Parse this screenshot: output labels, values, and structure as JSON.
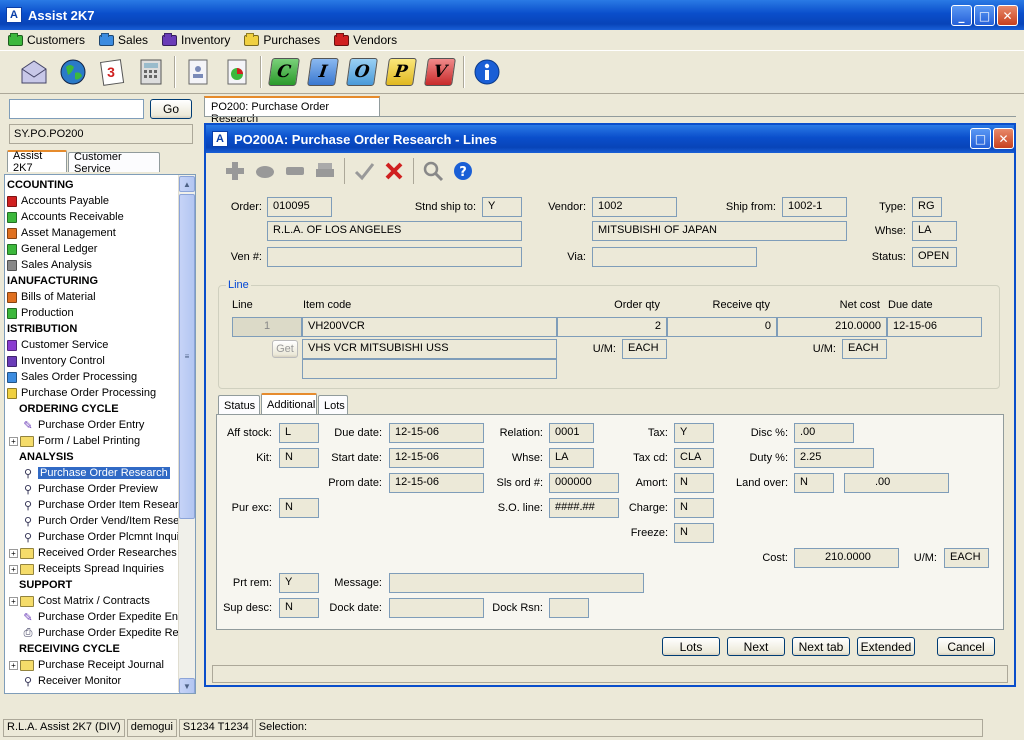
{
  "window": {
    "title": "Assist 2K7"
  },
  "menu": [
    {
      "label": "Customers",
      "color": "#3cb83c"
    },
    {
      "label": "Sales",
      "color": "#3c8ce0"
    },
    {
      "label": "Inventory",
      "color": "#6a3cb8"
    },
    {
      "label": "Purchases",
      "color": "#f0d040"
    },
    {
      "label": "Vendors",
      "color": "#d02020"
    }
  ],
  "toolbar": {
    "calendar_day": "3",
    "letters": [
      "C",
      "I",
      "O",
      "P",
      "V"
    ]
  },
  "left": {
    "search_value": "",
    "go_label": "Go",
    "path": "SY.PO.PO200",
    "tabs": [
      "Assist 2K7",
      "Customer Service"
    ]
  },
  "tree": {
    "items": [
      {
        "label": "CCOUNTING",
        "kind": "hdr"
      },
      {
        "label": "Accounts Payable",
        "kind": "item",
        "color": "#d02020"
      },
      {
        "label": "Accounts Receivable",
        "kind": "item",
        "color": "#3cb83c"
      },
      {
        "label": "Asset Management",
        "kind": "item",
        "color": "#e07020"
      },
      {
        "label": "General Ledger",
        "kind": "item",
        "color": "#3cb83c"
      },
      {
        "label": "Sales Analysis",
        "kind": "item",
        "color": "#888888"
      },
      {
        "label": "IANUFACTURING",
        "kind": "hdr"
      },
      {
        "label": "Bills of Material",
        "kind": "item",
        "color": "#e07020"
      },
      {
        "label": "Production",
        "kind": "item",
        "color": "#3cb83c"
      },
      {
        "label": "ISTRIBUTION",
        "kind": "hdr"
      },
      {
        "label": "Customer Service",
        "kind": "item",
        "color": "#8a3cd0"
      },
      {
        "label": "Inventory Control",
        "kind": "item",
        "color": "#6a3cb8"
      },
      {
        "label": "Sales Order Processing",
        "kind": "item",
        "color": "#3c8ce0"
      },
      {
        "label": "Purchase Order Processing",
        "kind": "item",
        "color": "#f0d040"
      },
      {
        "label": "ORDERING CYCLE",
        "kind": "sub"
      },
      {
        "label": "Purchase Order Entry",
        "kind": "leaf",
        "icon": "pencil"
      },
      {
        "label": "Form / Label Printing",
        "kind": "folder"
      },
      {
        "label": "ANALYSIS",
        "kind": "sub"
      },
      {
        "label": "Purchase Order Research",
        "kind": "leaf",
        "icon": "magnifier",
        "selected": true
      },
      {
        "label": "Purchase Order Preview",
        "kind": "leaf",
        "icon": "magnifier"
      },
      {
        "label": "Purchase Order Item Resear",
        "kind": "leaf",
        "icon": "magnifier"
      },
      {
        "label": "Purch Order Vend/Item Rese",
        "kind": "leaf",
        "icon": "magnifier"
      },
      {
        "label": "Purchase Order Plcmnt Inqui",
        "kind": "leaf",
        "icon": "magnifier"
      },
      {
        "label": "Received Order Researches",
        "kind": "folder"
      },
      {
        "label": "Receipts Spread Inquiries",
        "kind": "folder"
      },
      {
        "label": "SUPPORT",
        "kind": "sub"
      },
      {
        "label": "Cost Matrix / Contracts",
        "kind": "folder"
      },
      {
        "label": "Purchase Order Expedite Ent",
        "kind": "leaf",
        "icon": "pencil"
      },
      {
        "label": "Purchase Order Expedite Re",
        "kind": "leaf",
        "icon": "printer"
      },
      {
        "label": "RECEIVING CYCLE",
        "kind": "sub"
      },
      {
        "label": "Purchase Receipt Journal",
        "kind": "folder"
      },
      {
        "label": "Receiver Monitor",
        "kind": "leaf",
        "icon": "magnifier"
      }
    ]
  },
  "doc_tab": "PO200: Purchase Order Research",
  "inner": {
    "title": "PO200A: Purchase Order Research - Lines",
    "header": {
      "order_label": "Order:",
      "order": "010095",
      "stnd_ship_label": "Stnd ship to:",
      "stnd_ship": "Y",
      "vendor_label": "Vendor:",
      "vendor": "1002",
      "ship_from_label": "Ship from:",
      "ship_from": "1002-1",
      "type_label": "Type:",
      "type": "RG",
      "customer_name": "R.L.A. OF LOS ANGELES",
      "vendor_name": "MITSUBISHI OF JAPAN",
      "whse_label": "Whse:",
      "whse": "LA",
      "ven_label": "Ven #:",
      "ven": "",
      "via_label": "Via:",
      "via": "",
      "status_label": "Status:",
      "status": "OPEN"
    },
    "line": {
      "group_label": "Line",
      "col_line": "Line",
      "col_item": "Item code",
      "col_order_qty": "Order qty",
      "col_receive_qty": "Receive qty",
      "col_net_cost": "Net cost",
      "col_due_date": "Due date",
      "line_no": "1",
      "item_code": "VH200VCR",
      "order_qty": "2",
      "receive_qty": "0",
      "net_cost": "210.0000",
      "due_date": "12-15-06",
      "get_label": "Get",
      "description": "VHS VCR MITSUBISHI USS",
      "description2": "",
      "um_label": "U/M:",
      "um1": "EACH",
      "um2": "EACH"
    },
    "tabs": [
      "Status",
      "Additional",
      "Lots"
    ],
    "additional": {
      "aff_stock_label": "Aff stock:",
      "aff_stock": "L",
      "due_date_label": "Due date:",
      "due_date": "12-15-06",
      "relation_label": "Relation:",
      "relation": "0001",
      "tax_label": "Tax:",
      "tax": "Y",
      "disc_label": "Disc %:",
      "disc": ".00",
      "kit_label": "Kit:",
      "kit": "N",
      "start_date_label": "Start date:",
      "start_date": "12-15-06",
      "whse_label": "Whse:",
      "whse": "LA",
      "tax_cd_label": "Tax cd:",
      "tax_cd": "CLA",
      "duty_label": "Duty %:",
      "duty": "2.25",
      "prom_date_label": "Prom date:",
      "prom_date": "12-15-06",
      "sls_ord_label": "Sls ord #:",
      "sls_ord": "000000",
      "amort_label": "Amort:",
      "amort": "N",
      "land_over_label": "Land over:",
      "land_over": "N",
      "land_over_amt": ".00",
      "pur_exc_label": "Pur exc:",
      "pur_exc": "N",
      "so_line_label": "S.O. line:",
      "so_line": "####.##",
      "charge_label": "Charge:",
      "charge": "N",
      "freeze_label": "Freeze:",
      "freeze": "N",
      "cost_label": "Cost:",
      "cost": "210.0000",
      "um_label": "U/M:",
      "um": "EACH",
      "prt_rem_label": "Prt rem:",
      "prt_rem": "Y",
      "message_label": "Message:",
      "message": "",
      "sup_desc_label": "Sup desc:",
      "sup_desc": "N",
      "dock_date_label": "Dock date:",
      "dock_date": "",
      "dock_rsn_label": "Dock Rsn:",
      "dock_rsn": ""
    },
    "buttons": [
      "Lots",
      "Next",
      "Next tab",
      "Extended",
      "Cancel"
    ]
  },
  "statusbar": [
    "R.L.A. Assist 2K7 (DIV)",
    "demogui",
    "S1234 T1234",
    "Selection:"
  ]
}
